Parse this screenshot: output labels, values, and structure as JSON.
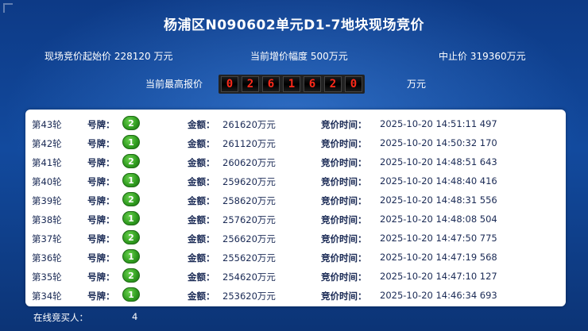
{
  "header": {
    "title": "杨浦区N090602单元D1-7地块现场竞价"
  },
  "info": {
    "start_price": "现场竞价起始价 228120 万元",
    "increment": "当前增价幅度 500万元",
    "stop_price": "中止价 319360万元"
  },
  "highest": {
    "label": "当前最高报价",
    "digits": [
      "0",
      "2",
      "6",
      "1",
      "6",
      "2",
      "0"
    ],
    "unit": "万元"
  },
  "labels": {
    "plate": "号牌：",
    "amount": "金额：",
    "time": "竞价时间："
  },
  "bids": [
    {
      "round": "第43轮",
      "plate": "2",
      "amount": "261620万元",
      "time": "2025-10-20 14:51:11 497"
    },
    {
      "round": "第42轮",
      "plate": "1",
      "amount": "261120万元",
      "time": "2025-10-20 14:50:32 170"
    },
    {
      "round": "第41轮",
      "plate": "2",
      "amount": "260620万元",
      "time": "2025-10-20 14:48:51 643"
    },
    {
      "round": "第40轮",
      "plate": "1",
      "amount": "259620万元",
      "time": "2025-10-20 14:48:40 416"
    },
    {
      "round": "第39轮",
      "plate": "2",
      "amount": "258620万元",
      "time": "2025-10-20 14:48:31 556"
    },
    {
      "round": "第38轮",
      "plate": "1",
      "amount": "257620万元",
      "time": "2025-10-20 14:48:08 504"
    },
    {
      "round": "第37轮",
      "plate": "2",
      "amount": "256620万元",
      "time": "2025-10-20 14:47:50 775"
    },
    {
      "round": "第36轮",
      "plate": "1",
      "amount": "255620万元",
      "time": "2025-10-20 14:47:19 568"
    },
    {
      "round": "第35轮",
      "plate": "2",
      "amount": "254620万元",
      "time": "2025-10-20 14:47:10 127"
    },
    {
      "round": "第34轮",
      "plate": "1",
      "amount": "253620万元",
      "time": "2025-10-20 14:46:34 693"
    }
  ],
  "footer": {
    "online_label": "在线竞买人：",
    "online_count": "4"
  },
  "colors": {
    "background": "#124a9e",
    "digit_red": "#ff2a1a",
    "badge_green": "#2e9a1e",
    "row_text": "#1a2a55"
  }
}
